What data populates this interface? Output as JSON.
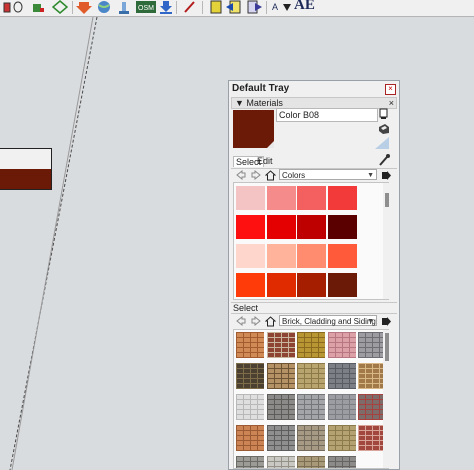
{
  "toolbar": {
    "icons": [
      "box-icon",
      "paint-bucket-icon",
      "shapes-icon",
      "download-arrow-icon",
      "globe-icon",
      "push-icon",
      "osm-icon",
      "import-icon",
      "pencil-icon",
      "notes-icon",
      "arrow-in-icon",
      "arrow-out-icon",
      "text-style-icon"
    ],
    "osm_text": "OSM",
    "ae_text": "AE"
  },
  "tray": {
    "title": "Default Tray",
    "close_glyph": "×",
    "materials_panel": {
      "header": "Materials",
      "close_glyph": "×",
      "current_color": "#6b1a08",
      "name_value": "Color B08",
      "tabs": [
        "Select",
        "Edit"
      ],
      "library_select": "Colors",
      "colors": [
        "#f4c4c4",
        "#f58b8b",
        "#f45f5f",
        "#f23a3a",
        "#ff1010",
        "#e40000",
        "#be0000",
        "#5a0000",
        "#ffd6cb",
        "#ffb39b",
        "#ff8c6f",
        "#ff5a3a",
        "#ff3b0a",
        "#e02a00",
        "#a51e00",
        "#6b1a08"
      ],
      "secondary_select_label": "Select",
      "library_select_2": "Brick, Cladding and Siding",
      "textures": [
        {
          "name": "orange-wood",
          "base": "#d08a55",
          "line": "#a35a2e"
        },
        {
          "name": "red-brick",
          "base": "#8d4433",
          "line": "#c9b59d"
        },
        {
          "name": "yellow-stone",
          "base": "#b99634",
          "line": "#8a6a1e"
        },
        {
          "name": "pink-tile",
          "base": "#dca1a6",
          "line": "#b77681"
        },
        {
          "name": "grey-cobble",
          "base": "#9d9ca0",
          "line": "#6d6d74"
        },
        {
          "name": "dark-stone",
          "base": "#4c4130",
          "line": "#7d6d48"
        },
        {
          "name": "tan-brick",
          "base": "#b49265",
          "line": "#6d5434"
        },
        {
          "name": "flagstone",
          "base": "#b7a46e",
          "line": "#8b7a48"
        },
        {
          "name": "grey-slate",
          "base": "#7d7f86",
          "line": "#5a5c63"
        },
        {
          "name": "siding-brown",
          "base": "#a27a4a",
          "line": "#d7b886"
        },
        {
          "name": "white-siding",
          "base": "#dedfde",
          "line": "#b8b8b8"
        },
        {
          "name": "rubble-stone",
          "base": "#8b8a88",
          "line": "#5e5c58"
        },
        {
          "name": "grey-brick",
          "base": "#a3a5a8",
          "line": "#74767a"
        },
        {
          "name": "grey-block",
          "base": "#9c9da3",
          "line": "#7c7d82"
        },
        {
          "name": "red-stone",
          "base": "#7e6c6b",
          "line": "#a5413e"
        },
        {
          "name": "orange-siding",
          "base": "#cc8455",
          "line": "#9a5a33"
        },
        {
          "name": "grey-rock",
          "base": "#8f8f8f",
          "line": "#5d5d5d"
        },
        {
          "name": "beige-stone",
          "base": "#a69a85",
          "line": "#756b5c"
        },
        {
          "name": "yellow-rock",
          "base": "#b4a272",
          "line": "#8a7a4c"
        },
        {
          "name": "red-brick-2",
          "base": "#a2473d",
          "line": "#d7a59a"
        },
        {
          "name": "grey-cobble-2",
          "base": "#9c9b96",
          "line": "#6a6a66"
        },
        {
          "name": "white-rock",
          "base": "#c9c8c2",
          "line": "#939188"
        },
        {
          "name": "tan-rock",
          "base": "#a89a78",
          "line": "#7b6e52"
        },
        {
          "name": "grey-wall",
          "base": "#8d8b89",
          "line": "#666462"
        }
      ]
    }
  }
}
